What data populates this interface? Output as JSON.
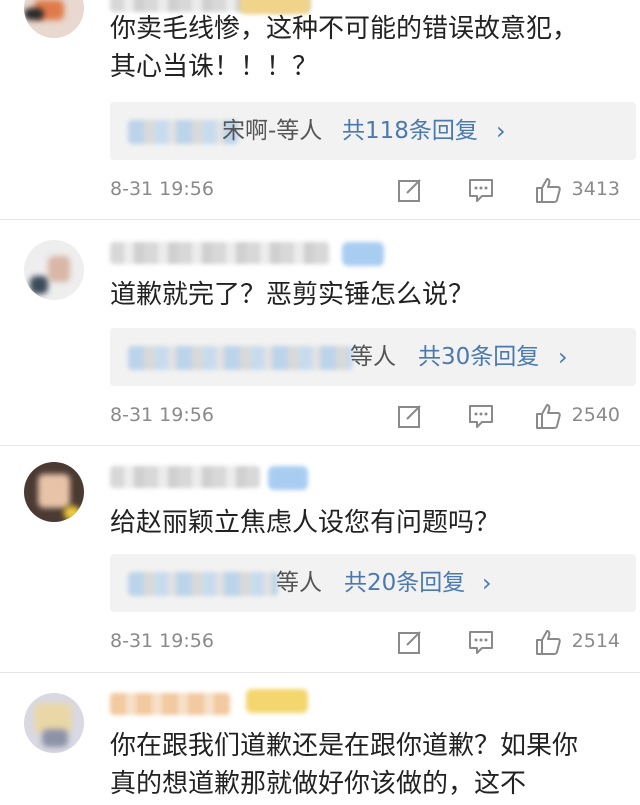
{
  "comments": [
    {
      "text": "你卖毛线惨，这种不可能的错误故意犯，其心当诛！！！？",
      "reply_suffix": "宋啊-等人",
      "reply_count": "共118条回复",
      "chevron": "›",
      "date": "8-31 19:56",
      "likes": "3413"
    },
    {
      "text": "道歉就完了？恶剪实锤怎么说？",
      "reply_suffix": "等人",
      "reply_count": "共30条回复",
      "chevron": "›",
      "date": "8-31 19:56",
      "likes": "2540"
    },
    {
      "text": "给赵丽颖立焦虑人设您有问题吗？",
      "reply_suffix": "等人",
      "reply_count": "共20条回复",
      "chevron": "›",
      "date": "8-31 19:56",
      "likes": "2514"
    },
    {
      "text": "你在跟我们道歉还是在跟你道歉？如果你真的想道歉那就做好你该做的，这不"
    }
  ],
  "icons": {
    "edit": "edit-icon",
    "reply": "comment-icon",
    "like": "thumbs-up-icon"
  },
  "colors": {
    "link": "#4a79b0",
    "meta": "#8a8a8a",
    "reply_bg": "#f2f2f2"
  }
}
